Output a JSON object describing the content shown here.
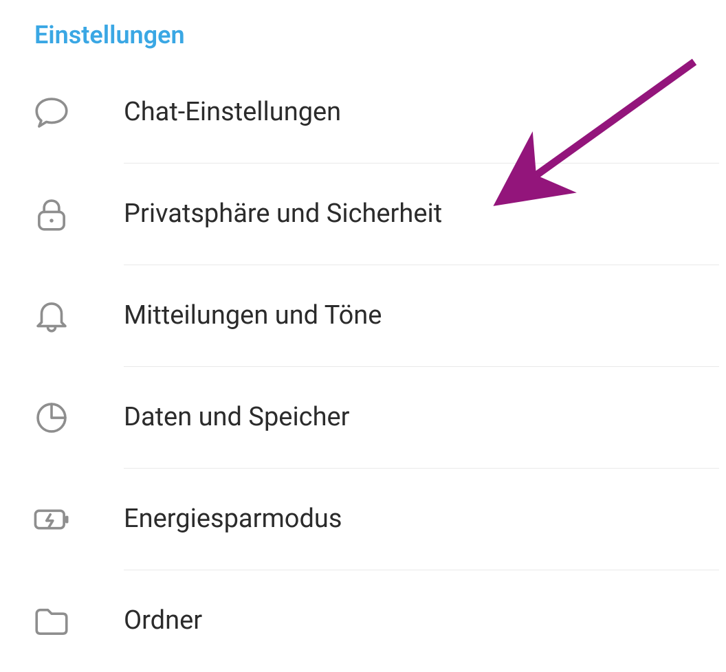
{
  "section_title": "Einstellungen",
  "menu": {
    "items": [
      {
        "icon": "chat-bubble-icon",
        "label": "Chat-Einstellungen"
      },
      {
        "icon": "lock-icon",
        "label": "Privatsphäre und Sicherheit"
      },
      {
        "icon": "bell-icon",
        "label": "Mitteilungen und Töne"
      },
      {
        "icon": "pie-chart-icon",
        "label": "Daten und Speicher"
      },
      {
        "icon": "battery-icon",
        "label": "Energiesparmodus"
      },
      {
        "icon": "folder-icon",
        "label": "Ordner"
      }
    ]
  },
  "annotation": {
    "arrow_color": "#93157b",
    "target_item_index": 1
  },
  "icon_stroke": "#8e8e8e"
}
